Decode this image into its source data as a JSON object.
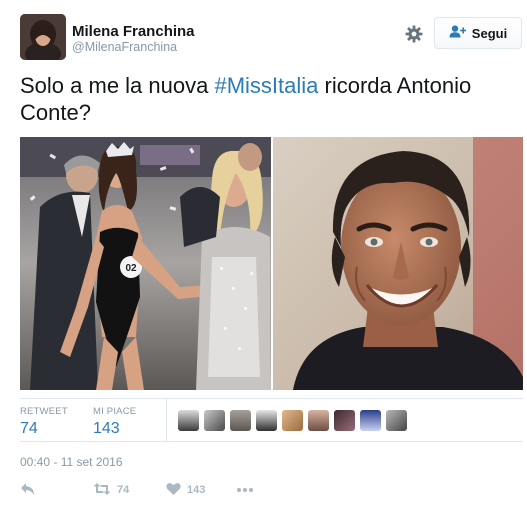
{
  "user": {
    "name": "Milena Franchina",
    "handle": "@MilenaFranchina",
    "follow_label": "Segui"
  },
  "tweet": {
    "text_before": "Solo a me la nuova ",
    "hashtag": "#MissItalia",
    "text_after": " ricorda Antonio Conte?"
  },
  "stats": {
    "retweet_label": "RETWEET",
    "retweet_count": "74",
    "likes_label": "MI PIACE",
    "likes_count": "143"
  },
  "timestamp": "00:40 - 11 set 2016",
  "actions": {
    "retweet_count": "74",
    "like_count": "143"
  },
  "colors": {
    "link": "#2b7bb9",
    "muted": "#8899a6",
    "border": "#e1e8ed",
    "icon": "#aab8c2"
  },
  "icons": [
    "gear-icon",
    "follow-person-plus-icon",
    "reply-icon",
    "retweet-icon",
    "heart-icon",
    "more-icon"
  ]
}
